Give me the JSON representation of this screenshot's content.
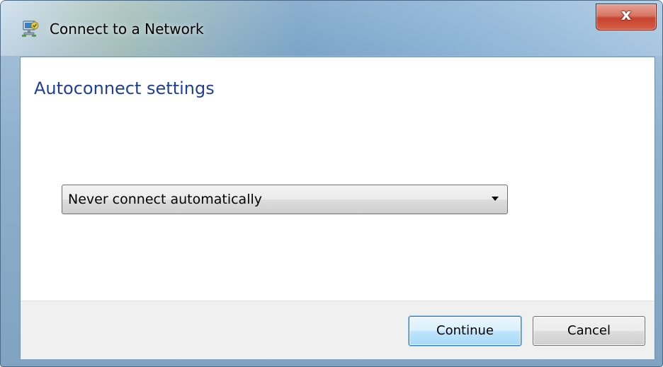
{
  "window": {
    "title": "Connect to a Network",
    "icon": "network-connection-icon",
    "close_icon": "close-icon",
    "close_glyph": "x"
  },
  "main": {
    "heading": "Autoconnect settings",
    "autoconnect_select": {
      "selected": "Never connect automatically"
    }
  },
  "footer": {
    "continue_label": "Continue",
    "cancel_label": "Cancel"
  },
  "colors": {
    "heading": "#1f3f99",
    "close_button": "#c7432d",
    "default_button_border": "#3c7fb1"
  }
}
